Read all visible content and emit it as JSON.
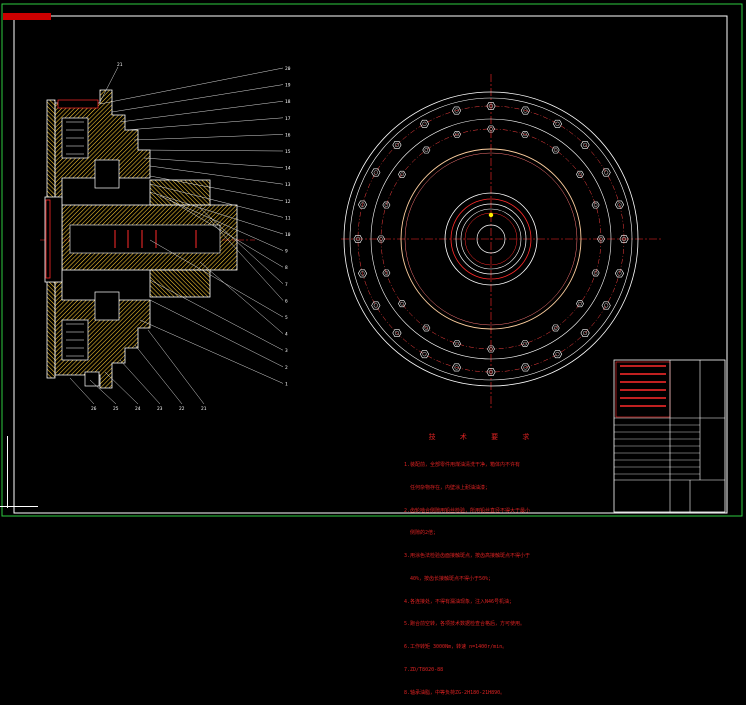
{
  "sheet": {
    "tab_label": "",
    "background": "#000000",
    "frame_color": "#ffffff",
    "border_color": "#2ecc40"
  },
  "colors": {
    "outline": "#ffffff",
    "hatch": "#ffcc33",
    "centerline": "#ff2a2a",
    "hole_circle": "#ff4040",
    "leader": "#d8d8d8",
    "notes": "#dd2222",
    "marker": "#ffee00"
  },
  "section_view": {
    "part_numbers_right": [
      "20",
      "19",
      "18",
      "17",
      "16",
      "15",
      "14",
      "13",
      "12",
      "11",
      "10",
      "9",
      "8",
      "7",
      "6",
      "5",
      "4",
      "3",
      "2",
      "1"
    ],
    "part_numbers_bottom": [
      "26",
      "25",
      "24",
      "23",
      "22",
      "21"
    ],
    "part_number_top": "21"
  },
  "front_view": {
    "bolt_holes_outer": 24,
    "bolt_holes_inner": 20
  },
  "technical_requirements": {
    "title": "技 术 要 求",
    "lines": [
      "1.装配前，全部零件用煤油清洗干净，箱体内不许有",
      "  任何杂物存在，内壁涂上耐油油漆；",
      "2.齿轮啮合侧隙用铅丝检验，所用铅丝直径不得大于最小",
      "  侧隙的2倍；",
      "3.用涂色法检验齿面接触斑点，按齿高接触斑点不得小于",
      "  40%，按齿长接触斑点不得小于50%；",
      "4.各连接处，不得有漏油现象，注入N46号机油；",
      "5.跑合前空转，各项技术数据检查合格后，方可使用。",
      "6.工作转矩 3000Nm，转速 n=1400r/min。",
      "7.ZD/T8020-88",
      "8.轴承油脂，中等负荷ZG-2H180-21H890。"
    ]
  },
  "title_block": {
    "rows": 8
  }
}
